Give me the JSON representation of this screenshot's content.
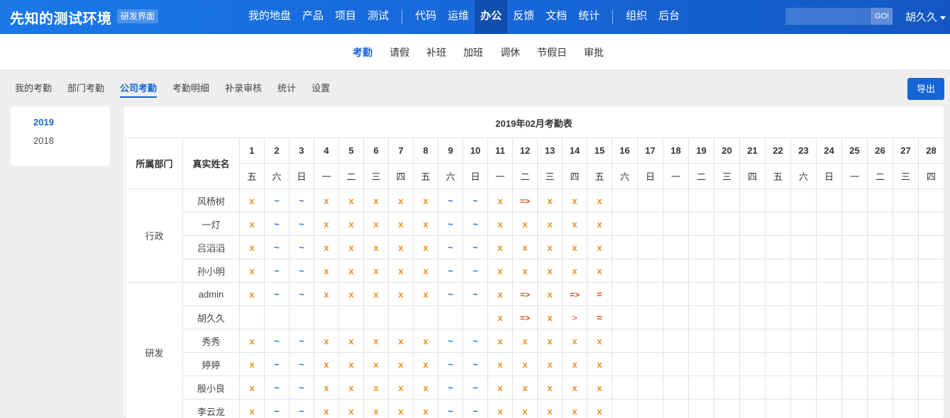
{
  "topbar": {
    "brand": "先知的测试环境",
    "badge": "研发界面",
    "nav": [
      {
        "label": "我的地盘"
      },
      {
        "label": "产品"
      },
      {
        "label": "项目"
      },
      {
        "label": "测试"
      },
      {
        "sep": true
      },
      {
        "label": "代码"
      },
      {
        "label": "运维"
      },
      {
        "label": "办公",
        "active": true
      },
      {
        "label": "反馈"
      },
      {
        "label": "文档"
      },
      {
        "label": "统计"
      },
      {
        "sep": true
      },
      {
        "label": "组织"
      },
      {
        "label": "后台"
      }
    ],
    "search_value": "",
    "search_button": "GO!",
    "user": "胡久久"
  },
  "subnav": [
    {
      "label": "考勤",
      "active": true
    },
    {
      "label": "请假"
    },
    {
      "label": "补班"
    },
    {
      "label": "加班"
    },
    {
      "label": "调休"
    },
    {
      "label": "节假日"
    },
    {
      "label": "审批"
    }
  ],
  "thirdnav": [
    {
      "label": "我的考勤"
    },
    {
      "label": "部门考勤"
    },
    {
      "label": "公司考勤",
      "active": true
    },
    {
      "label": "考勤明细"
    },
    {
      "label": "补录审核"
    },
    {
      "label": "统计"
    },
    {
      "label": "设置"
    }
  ],
  "export_button": "导出",
  "years": [
    {
      "label": "2019",
      "active": true
    },
    {
      "label": "2018"
    }
  ],
  "table": {
    "title": "2019年02月考勤表",
    "header_dept": "所属部门",
    "header_name": "真实姓名",
    "days": [
      "1",
      "2",
      "3",
      "4",
      "5",
      "6",
      "7",
      "8",
      "9",
      "10",
      "11",
      "12",
      "13",
      "14",
      "15",
      "16",
      "17",
      "18",
      "19",
      "20",
      "21",
      "22",
      "23",
      "24",
      "25",
      "26",
      "27",
      "28"
    ],
    "weekdays": [
      "五",
      "六",
      "日",
      "一",
      "二",
      "三",
      "四",
      "五",
      "六",
      "日",
      "一",
      "二",
      "三",
      "四",
      "五",
      "六",
      "日",
      "一",
      "二",
      "三",
      "四",
      "五",
      "六",
      "日",
      "一",
      "二",
      "三",
      "四"
    ],
    "groups": [
      {
        "dept": "行政",
        "rows": [
          {
            "name": "风杨树",
            "marks": [
              "x",
              "~",
              "~",
              "x",
              "x",
              "x",
              "x",
              "x",
              "~",
              "~",
              "x",
              "=>",
              "x",
              "x",
              "x"
            ]
          },
          {
            "name": "一灯",
            "marks": [
              "x",
              "~",
              "~",
              "x",
              "x",
              "x",
              "x",
              "x",
              "~",
              "~",
              "x",
              "x",
              "x",
              "x",
              "x"
            ]
          },
          {
            "name": "吕滔滔",
            "marks": [
              "x",
              "~",
              "~",
              "x",
              "x",
              "x",
              "x",
              "x",
              "~",
              "~",
              "x",
              "x",
              "x",
              "x",
              "x"
            ]
          },
          {
            "name": "孙小明",
            "marks": [
              "x",
              "~",
              "~",
              "x",
              "x",
              "x",
              "x",
              "x",
              "~",
              "~",
              "x",
              "x",
              "x",
              "x",
              "x"
            ]
          }
        ]
      },
      {
        "dept": "研发",
        "rows": [
          {
            "name": "admin",
            "marks": [
              "x",
              "~",
              "~",
              "x",
              "x",
              "x",
              "x",
              "x",
              "~",
              "~",
              "x",
              "=>",
              "x",
              "=>",
              "="
            ]
          },
          {
            "name": "胡久久",
            "marks": [
              "",
              "",
              "",
              "",
              "",
              "",
              "",
              "",
              "",
              "",
              "x",
              "=>",
              "x",
              ">",
              "="
            ]
          },
          {
            "name": "秀秀",
            "marks": [
              "x",
              "~",
              "~",
              "x",
              "x",
              "x",
              "x",
              "x",
              "~",
              "~",
              "x",
              "x",
              "x",
              "x",
              "x"
            ]
          },
          {
            "name": "婷婷",
            "marks": [
              "x",
              "~",
              "~",
              "x",
              "x",
              "x",
              "x",
              "x",
              "~",
              "~",
              "x",
              "x",
              "x",
              "x",
              "x"
            ]
          },
          {
            "name": "殷小良",
            "marks": [
              "x",
              "~",
              "~",
              "x",
              "x",
              "x",
              "x",
              "x",
              "~",
              "~",
              "x",
              "x",
              "x",
              "x",
              "x"
            ]
          },
          {
            "name": "李云龙",
            "marks": [
              "x",
              "~",
              "~",
              "x",
              "x",
              "x",
              "x",
              "x",
              "~",
              "~",
              "x",
              "x",
              "x",
              "x",
              "x"
            ]
          }
        ]
      }
    ]
  },
  "colors": {
    "primary": "#1665d6",
    "absent_mark": "#f0901e",
    "rest_mark": "#1a73d9",
    "alert_mark": "#e04a1a"
  }
}
